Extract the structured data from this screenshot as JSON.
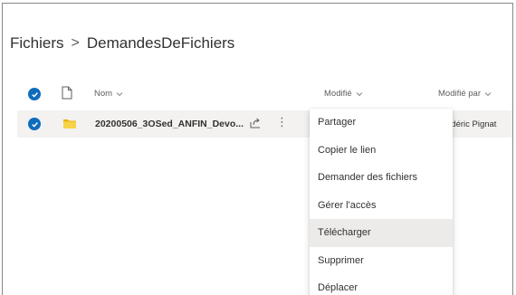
{
  "breadcrumb": {
    "root": "Fichiers",
    "separator": ">",
    "current": "DemandesDeFichiers"
  },
  "columns": {
    "name": "Nom",
    "modified": "Modifié",
    "modified_by": "Modifié par"
  },
  "file": {
    "name": "20200506_3OSed_ANFIN_Devo...",
    "modified_by": "édéric Pignat",
    "selected": true
  },
  "context_menu": {
    "items": [
      {
        "label": "Partager"
      },
      {
        "label": "Copier le lien"
      },
      {
        "label": "Demander des fichiers"
      },
      {
        "label": "Gérer l'accès"
      },
      {
        "label": "Télécharger"
      },
      {
        "label": "Supprimer"
      },
      {
        "label": "Déplacer"
      }
    ],
    "hovered": "Télécharger"
  },
  "colors": {
    "accent": "#0f6cbd",
    "folder": "#f2c811",
    "row_selected": "#f3f2f1",
    "menu_hover": "#edebe9"
  }
}
